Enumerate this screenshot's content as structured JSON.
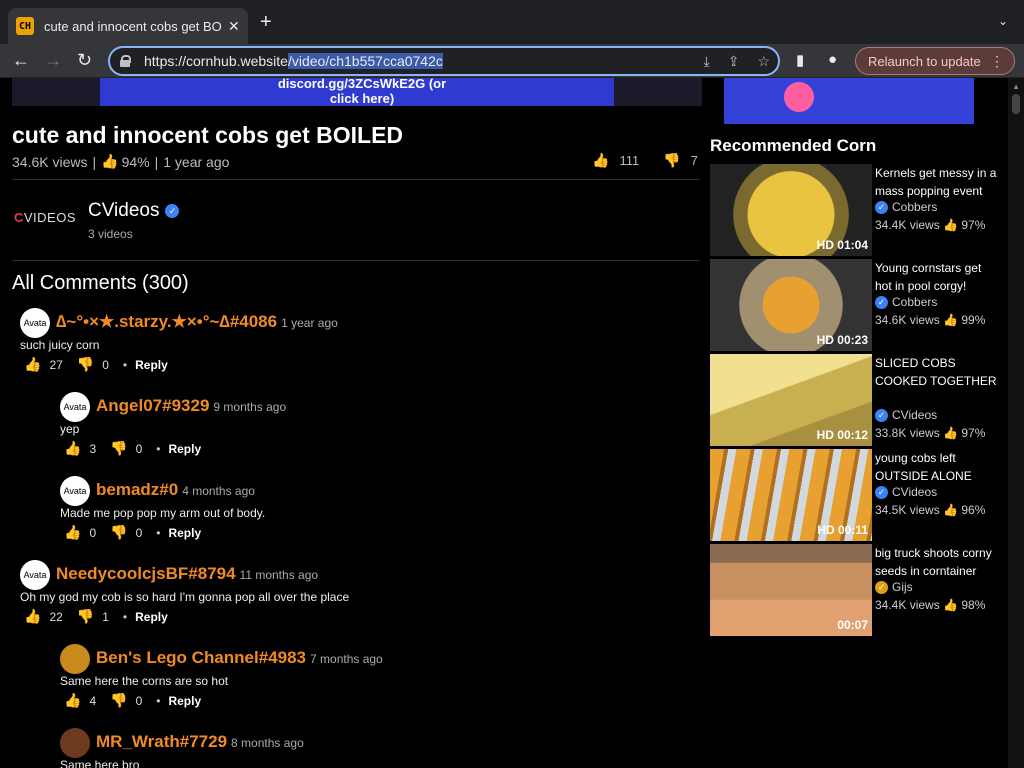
{
  "browser": {
    "tab_title": "cute and innocent cobs get BOILED",
    "favicon_text": "CH",
    "url_prefix": "https://cornhub.website",
    "url_selected": "/video/ch1b557cca0742c",
    "relaunch_label": "Relaunch to update"
  },
  "banner": {
    "text": "discord.gg/3ZCsWkE2G (or click here)"
  },
  "video": {
    "title": "cute and innocent cobs get BOILED",
    "views": "34.6K views",
    "rating": "94%",
    "age": "1 year ago",
    "likes": "111",
    "dislikes": "7"
  },
  "channel": {
    "logo_text_red": "C",
    "logo_text": "VIDEOS",
    "name": "CVideos",
    "video_count": "3 videos"
  },
  "comments_header": "All Comments (300)",
  "comments": [
    {
      "avatar": "Avata",
      "name": "∆~°•×★.starzy.★×•°~∆#4086",
      "time": "1 year ago",
      "text": "such juicy corn",
      "likes": "27",
      "dislikes": "0",
      "reply": "Reply"
    },
    {
      "avatar": "Avata",
      "name": "Angel07#9329",
      "time": "9 months ago",
      "text": "yep",
      "likes": "3",
      "dislikes": "0",
      "reply": "Reply"
    },
    {
      "avatar": "Avata",
      "name": "bemadz#0",
      "time": "4 months ago",
      "text": "Made me pop pop my arm out of body.",
      "likes": "0",
      "dislikes": "0",
      "reply": "Reply"
    },
    {
      "avatar": "Avata",
      "name": "NeedycoolcjsBF#8794",
      "time": "11 months ago",
      "text": "Oh my god my cob is so hard I'm gonna pop all over the place",
      "likes": "22",
      "dislikes": "1",
      "reply": "Reply"
    },
    {
      "avatar": "",
      "name": "Ben's Lego Channel#4983",
      "time": "7 months ago",
      "text": "Same here the corns are so hot",
      "likes": "4",
      "dislikes": "0",
      "reply": "Reply"
    },
    {
      "avatar": "",
      "name": "MR_Wrath#7729",
      "time": "8 months ago",
      "text": "Same here bro",
      "likes": "",
      "dislikes": "",
      "reply": ""
    }
  ],
  "recommended": {
    "header": "Recommended Corn",
    "items": [
      {
        "title": "Kernels get messy in a mass popping event",
        "channel": "Cobbers",
        "views": "34.4K views",
        "rating": "97%",
        "hd": "HD",
        "duration": "01:04",
        "color": "#c9a93a"
      },
      {
        "title": "Young cornstars get hot in pool corgy!",
        "channel": "Cobbers",
        "views": "34.6K views",
        "rating": "99%",
        "hd": "HD",
        "duration": "00:23",
        "color": "#8b7a4a"
      },
      {
        "title": "SLICED COBS COOKED TOGETHER",
        "channel": "CVideos",
        "views": "33.8K views",
        "rating": "97%",
        "hd": "HD",
        "duration": "00:12",
        "color": "#e8d070"
      },
      {
        "title": "young cobs left OUTSIDE ALONE",
        "channel": "CVideos",
        "views": "34.5K views",
        "rating": "96%",
        "hd": "HD",
        "duration": "00:11",
        "color": "#d89a30"
      },
      {
        "title": "big truck shoots corny seeds in corntainer",
        "channel": "Gijs",
        "views": "34.4K views",
        "rating": "98%",
        "hd": "",
        "duration": "00:07",
        "color": "#c88850"
      }
    ]
  }
}
